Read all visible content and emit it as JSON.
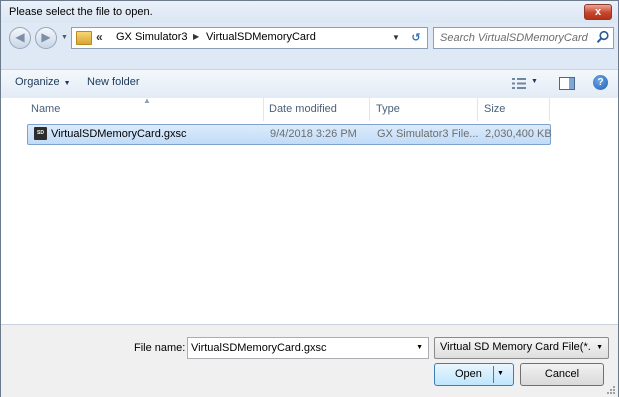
{
  "window": {
    "title": "Please select the file to open.",
    "close_label": "x"
  },
  "address": {
    "crumbs": [
      "GX Simulator3",
      "VirtualSDMemoryCard"
    ],
    "overflow_chevron": "«",
    "search_placeholder": "Search VirtualSDMemoryCard"
  },
  "toolbar": {
    "organize_label": "Organize",
    "new_folder_label": "New folder"
  },
  "columns": [
    "Name",
    "Date modified",
    "Type",
    "Size"
  ],
  "files": [
    {
      "name": "VirtualSDMemoryCard.gxsc",
      "date_modified": "9/4/2018 3:26 PM",
      "type": "GX Simulator3 File...",
      "size": "2,030,400 KB",
      "icon": "sd-card-icon",
      "icon_text": "SD",
      "selected": true
    }
  ],
  "bottom": {
    "file_name_label": "File name:",
    "file_name_value": "VirtualSDMemoryCard.gxsc",
    "file_type_value": "Virtual SD Memory Card File(*.gxsc)",
    "open_label": "Open",
    "cancel_label": "Cancel"
  },
  "colors": {
    "accent": "#3c7fb1",
    "selection": "#c1dcf8",
    "close": "#c9452c"
  }
}
